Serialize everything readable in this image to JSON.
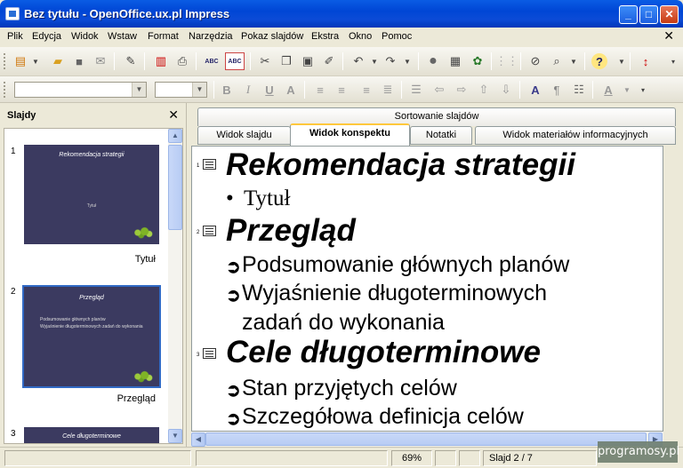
{
  "window": {
    "title": "Bez tytułu - OpenOffice.ux.pl Impress",
    "min": "_",
    "max": "□",
    "close": "✕"
  },
  "menu": [
    "Plik",
    "Edycja",
    "Widok",
    "Wstaw",
    "Format",
    "Narzędzia",
    "Pokaz slajdów",
    "Ekstra",
    "Okno",
    "Pomoc"
  ],
  "menu_close": "✕",
  "toolbar1_icons": [
    "new-icon",
    "open-icon",
    "save-icon",
    "email-icon",
    "edit-icon",
    "pdf-icon",
    "print-icon",
    "spellcheck-icon",
    "autospell-icon",
    "cut-icon",
    "copy-icon",
    "paste-icon",
    "format-paint-icon",
    "undo-icon",
    "redo-icon",
    "chart-icon",
    "table-icon",
    "navigator-icon",
    "grid-icon",
    "display-icon",
    "zoom-icon",
    "help-icon"
  ],
  "toolbar2": {
    "font_name": "",
    "font_size": ""
  },
  "slides_panel": {
    "title": "Slajdy",
    "close": "✕",
    "slides": [
      {
        "num": "1",
        "title": "Rekomendacja strategii",
        "subtitle": "Tytuł",
        "label": "Tytuł"
      },
      {
        "num": "2",
        "title": "Przegląd",
        "bullets": [
          "Podsumowanie głównych planów",
          "Wyjaśnienie długoterminowych zadań do wykonania"
        ],
        "label": "Przegląd"
      },
      {
        "num": "3",
        "title": "Cele długoterminowe"
      }
    ]
  },
  "tabs": {
    "top": "Sortowanie slajdów",
    "items": [
      "Widok slajdu",
      "Widok konspektu",
      "Notatki",
      "Widok materiałów informacyjnych"
    ],
    "active": "Widok konspektu"
  },
  "outline": [
    {
      "slide_no": "1",
      "title": "Rekomendacja strategii",
      "bullets": [
        {
          "style": "dot",
          "text": "Tytuł"
        }
      ]
    },
    {
      "slide_no": "2",
      "title": "Przegląd",
      "bullets": [
        {
          "style": "arrow",
          "text": "Podsumowanie głównych planów"
        },
        {
          "style": "arrow",
          "text": "Wyjaśnienie długoterminowych",
          "cont": "zadań do wykonania"
        }
      ]
    },
    {
      "slide_no": "3",
      "title": "Cele długoterminowe",
      "bullets": [
        {
          "style": "arrow",
          "text": "Stan przyjętych celów"
        },
        {
          "style": "arrow",
          "text": "Szczegółowa definicja celów"
        }
      ]
    }
  ],
  "status": {
    "zoom": "69%",
    "slide": "Slajd 2 / 7",
    "layout": "prs-strategy"
  },
  "watermark": "programosy.pl",
  "colors": {
    "titlebar": "#0054e3",
    "thumb_bg": "#3b3a60",
    "active_tab": "#ffc83c",
    "selection": "#316ac5"
  }
}
